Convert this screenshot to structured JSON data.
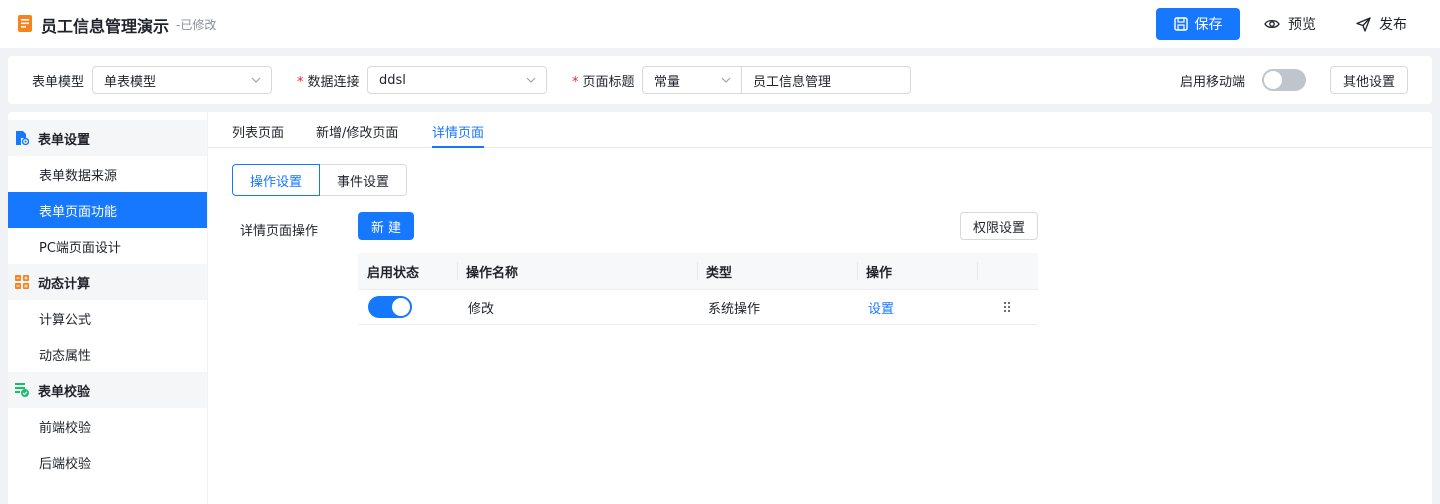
{
  "header": {
    "title": "员工信息管理演示",
    "status": "-已修改",
    "save_label": "保存",
    "preview_label": "预览",
    "publish_label": "发布"
  },
  "toolbar": {
    "form_model_label": "表单模型",
    "form_model_value": "单表模型",
    "required_mark": "*",
    "data_conn_label": "数据连接",
    "data_conn_value": "ddsl",
    "page_title_label": "页面标题",
    "page_title_type": "常量",
    "page_title_value": "员工信息管理",
    "mobile_label": "启用移动端",
    "mobile_enabled": false,
    "other_settings_label": "其他设置"
  },
  "sidebar": {
    "groups": [
      {
        "label": "表单设置",
        "icon": "form-settings-icon",
        "items": [
          "表单数据来源",
          "表单页面功能",
          "PC端页面设计"
        ]
      },
      {
        "label": "动态计算",
        "icon": "calculator-icon",
        "items": [
          "计算公式",
          "动态属性"
        ]
      },
      {
        "label": "表单校验",
        "icon": "form-check-icon",
        "items": [
          "前端校验",
          "后端校验"
        ]
      }
    ],
    "active_item": "表单页面功能"
  },
  "tabs": [
    "列表页面",
    "新增/修改页面",
    "详情页面"
  ],
  "active_tab": "详情页面",
  "segments": [
    "操作设置",
    "事件设置"
  ],
  "active_segment": "操作设置",
  "section": {
    "label": "详情页面操作",
    "new_label": "新建",
    "permission_label": "权限设置"
  },
  "table": {
    "columns": [
      "启用状态",
      "操作名称",
      "类型",
      "操作"
    ],
    "rows": [
      {
        "enabled": true,
        "name": "修改",
        "type": "系统操作",
        "action": "设置"
      }
    ]
  },
  "colors": {
    "primary": "#1677ff",
    "icon_orange": "#f5841f",
    "icon_blue": "#1677ff",
    "icon_green": "#19be6b"
  }
}
